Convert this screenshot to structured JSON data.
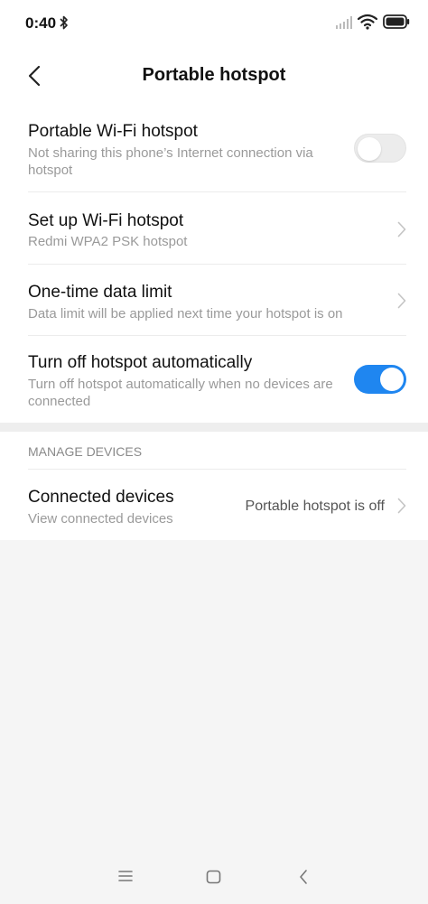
{
  "status_bar": {
    "time": "0:40",
    "icons": [
      "bluetooth-icon",
      "signal-icon",
      "wifi-icon",
      "battery-icon"
    ]
  },
  "header": {
    "title": "Portable hotspot",
    "back_icon": "chevron-left-icon"
  },
  "settings": {
    "portable_wifi": {
      "title": "Portable Wi-Fi hotspot",
      "subtitle": "Not sharing this phone’s Internet connection via hotspot",
      "enabled": false
    },
    "setup": {
      "title": "Set up Wi-Fi hotspot",
      "subtitle": "Redmi WPA2 PSK hotspot"
    },
    "data_limit": {
      "title": "One-time data limit",
      "subtitle": "Data limit will be applied next time your hotspot is on"
    },
    "auto_off": {
      "title": "Turn off hotspot automatically",
      "subtitle": "Turn off hotspot automatically when no devices are connected",
      "enabled": true
    }
  },
  "manage": {
    "header": "MANAGE DEVICES",
    "connected": {
      "title": "Connected devices",
      "subtitle": "View connected devices",
      "value": "Portable hotspot is off"
    }
  },
  "colors": {
    "accent": "#1f86f0",
    "background": "#f5f5f5",
    "card": "#ffffff",
    "secondary_text": "#9a9a9a"
  },
  "nav_bar": {
    "icons": [
      "menu-icon",
      "home-icon",
      "back-icon"
    ]
  }
}
